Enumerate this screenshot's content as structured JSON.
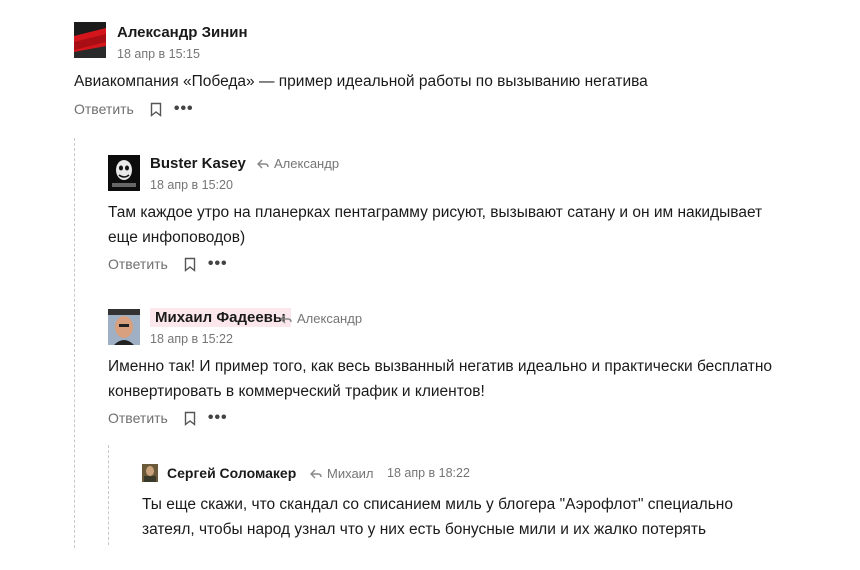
{
  "comments": [
    {
      "author": "Александр Зинин",
      "date": "18 апр в 15:15",
      "reply_to": "",
      "text_lines": [
        "Авиакомпания «Победа» — пример идеальной работы по вызыванию негатива"
      ],
      "reply_label": "Ответить"
    },
    {
      "author": "Buster Kasey",
      "date": "18 апр в 15:20",
      "reply_to": "Александр",
      "text_lines": [
        "Там каждое утро на планерках пентаграмму рисуют, вызывают сатану и он им накидывает",
        "еще инфоповодов)"
      ],
      "reply_label": "Ответить"
    },
    {
      "author": "Михаил Фадеевы",
      "date": "18 апр в 15:22",
      "reply_to": "Александр",
      "text_lines": [
        "Именно так! И пример того, как весь вызванный негатив идеально и практически бесплатно",
        "конвертировать в коммерческий трафик и клиентов!"
      ],
      "reply_label": "Ответить"
    },
    {
      "author": "Сергей Соломакер",
      "date": "18 апр в 18:22",
      "reply_to": "Михаил",
      "text_lines": [
        "Ты еще скажи, что скандал со списанием миль у блогера \"Аэрофлот\" специально",
        "затеял, чтобы народ узнал что у них есть бонусные мили и их жалко потерять"
      ],
      "reply_label": ""
    }
  ],
  "icons": {
    "reply_arrow": "reply-arrow-icon",
    "bookmark": "bookmark-icon",
    "more": "more-dots-icon"
  },
  "colors": {
    "author_highlight": "#fce8ec",
    "muted_text": "#757575",
    "thread_line": "#c8c8c8"
  }
}
